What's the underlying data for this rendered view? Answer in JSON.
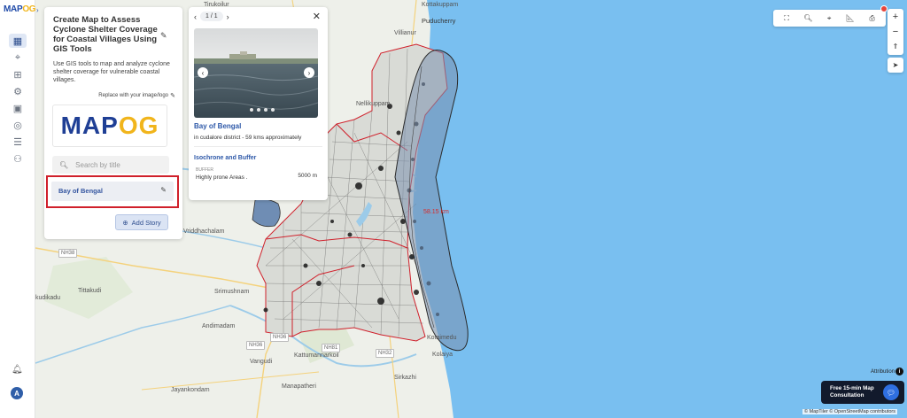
{
  "app": {
    "logo_main": "MAP",
    "logo_accent": "OG"
  },
  "story_panel": {
    "title": "Create Map to Assess Cyclone Shelter Coverage for Coastal Villages Using GIS Tools",
    "description": "Use GIS tools to map and analyze cyclone shelter coverage for vulnerable coastal villages.",
    "replace_label": "Replace with your image/logo",
    "logo_main": "MAP",
    "logo_accent": "OG",
    "search_placeholder": "Search by title",
    "stories": [
      {
        "label": "Bay of Bengal"
      }
    ],
    "add_story_label": "Add Story"
  },
  "popup": {
    "pager": "1 / 1",
    "title": "Bay of Bengal",
    "description": "in cudalore district - 59 kms approximately",
    "layer_name": "Isochrone and Buffer",
    "field_header": "BUFFER",
    "field_key": "Highly prone Areas .",
    "field_value": "5000 m"
  },
  "map": {
    "distance_label": "58.15 km",
    "labels": {
      "tirukolur": "Tirukoilur",
      "puducherry": "Puducherry",
      "kottakuppam": "Kottakuppam",
      "villianur": "Villianur",
      "nellikuppam": "Nellikuppam",
      "vriddhachalam": "Vriddhachalam",
      "tittakudi": "Tittakudi",
      "srimushnam": "Srimushnam",
      "kudikadu": "kudikadu",
      "andimadam": "Andimadam",
      "kattumannarkoil": "Kattumannarkoil",
      "vanguli": "Vangudi",
      "jayankondam": "Jayankondam",
      "manapatheri": "Manapatheri",
      "sirkazhi": "Sirkazhi",
      "kolaiya": "Kolaiya",
      "kotaimedu": "Kotaimedu"
    },
    "road_signs": [
      "NH38",
      "NH36",
      "NH81",
      "NH32",
      "NH36"
    ]
  },
  "attribution": {
    "label": "Attribution",
    "credits": "© MapTiler © OpenStreetMap contributors"
  },
  "consult": {
    "text": "Free 15-min Map Consultation"
  },
  "colors": {
    "sea": "#79bff0",
    "land": "#eef0ea",
    "buffer": "#7a8fae",
    "boundary": "#d0202b",
    "accent": "#2d58a8"
  }
}
